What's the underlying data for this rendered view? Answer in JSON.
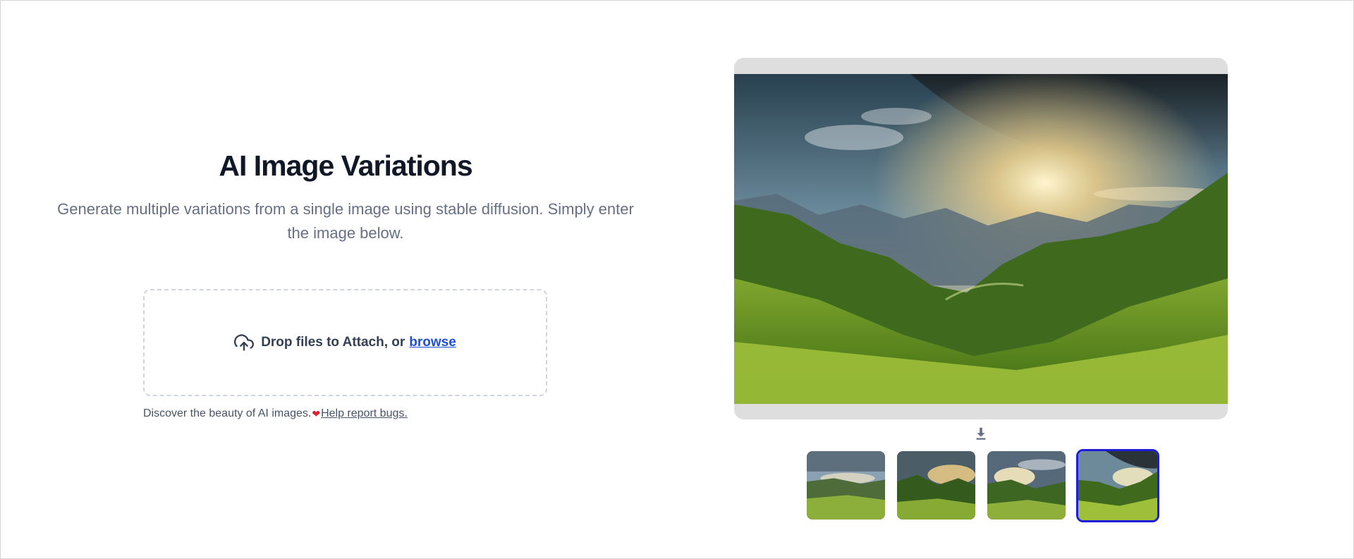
{
  "hero": {
    "title": "AI Image Variations",
    "subtitle": "Generate multiple variations from a single image using stable diffusion. Simply enter the image below."
  },
  "upload": {
    "prompt_text": "Drop files to Attach, or",
    "browse_label": "browse",
    "icon": "cloud-upload-icon"
  },
  "footer": {
    "discover_text": "Discover the beauty of AI images.",
    "heart_icon": "heart-icon",
    "bug_link_label": "Help report bugs."
  },
  "preview": {
    "download_icon": "download-icon",
    "thumbnail_count": 4,
    "selected_thumbnail": 4
  },
  "colors": {
    "accent": "#1d4ed8",
    "selected_border": "#1d1ddb",
    "heart": "#e11d2e"
  }
}
